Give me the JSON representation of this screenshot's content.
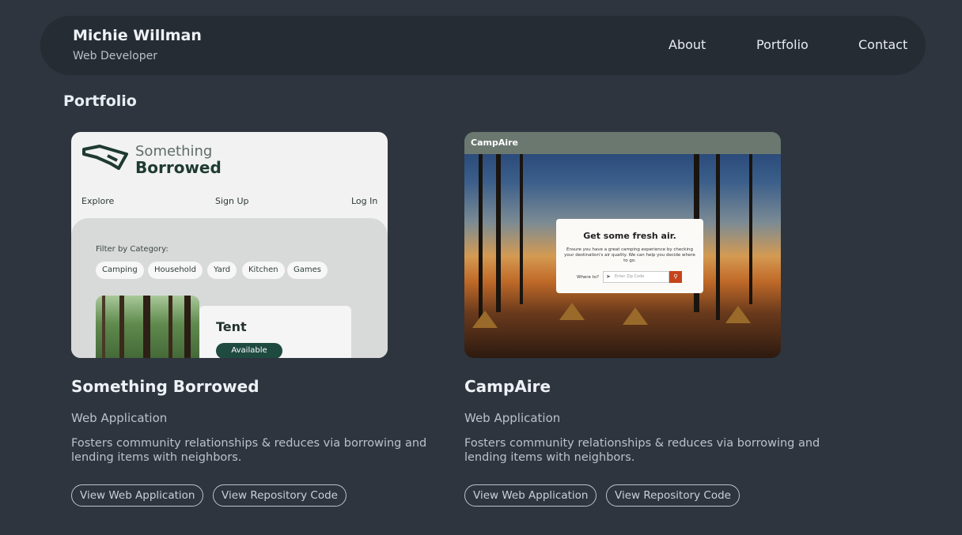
{
  "header": {
    "name": "Michie Willman",
    "role": "Web Developer",
    "nav": [
      "About",
      "Portfolio",
      "Contact"
    ]
  },
  "section_title": "Portfolio",
  "projects": [
    {
      "title": "Something Borrowed",
      "type": "Web Application",
      "description": "Fosters community relationships & reduces via borrowing and lending items with neighbors.",
      "buttons": [
        "View Web Application",
        "View Repository Code"
      ],
      "thumbnail": {
        "logo_line1": "Something",
        "logo_line2": "Borrowed",
        "nav": [
          "Explore",
          "Sign Up",
          "Log In"
        ],
        "filter_label": "Filter by Category:",
        "chips": [
          "Camping",
          "Household",
          "Yard",
          "Kitchen",
          "Games"
        ],
        "item_title": "Tent",
        "item_status": "Available"
      }
    },
    {
      "title": "CampAire",
      "type": "Web Application",
      "description": "Fosters community relationships & reduces via borrowing and lending items with neighbors.",
      "buttons": [
        "View Web Application",
        "View Repository Code"
      ],
      "thumbnail": {
        "app_name": "CampAire",
        "heading": "Get some fresh air.",
        "text": "Ensure you have a great camping experience by checking your destination's air quality. We can help you decide where to go.",
        "input_label": "Where to?",
        "input_placeholder": "Enter Zip Code"
      }
    }
  ],
  "colors": {
    "background": "#2e353e",
    "navbar": "#262c34",
    "text": "#e6ebf0",
    "muted": "#b9c2cb"
  }
}
